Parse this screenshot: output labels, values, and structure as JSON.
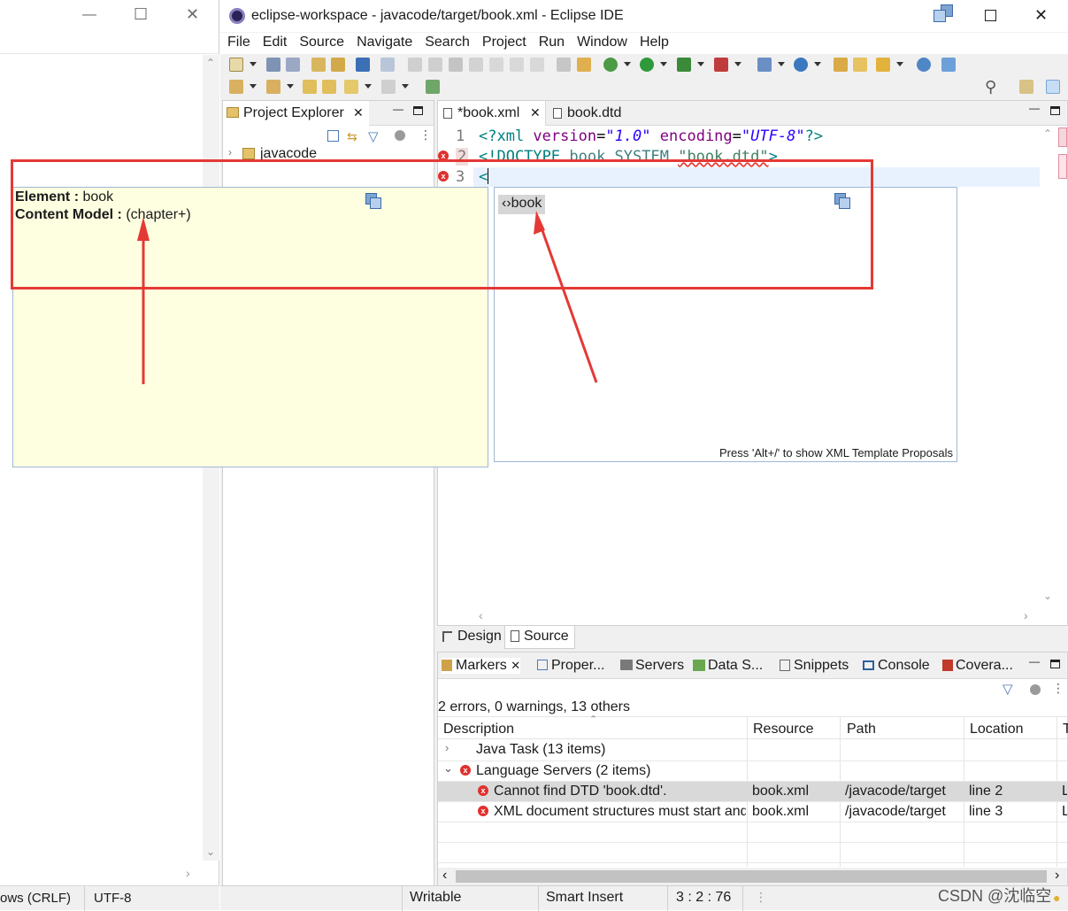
{
  "left_window": {
    "status_left": "ows (CRLF)",
    "status_encoding": "UTF-8"
  },
  "titlebar": {
    "title": "eclipse-workspace - javacode/target/book.xml - Eclipse IDE"
  },
  "menu": [
    "File",
    "Edit",
    "Source",
    "Navigate",
    "Search",
    "Project",
    "Run",
    "Window",
    "Help"
  ],
  "project_explorer": {
    "tab_label": "Project Explorer",
    "tree_item": "javacode"
  },
  "editor": {
    "tabs": [
      {
        "label": "*book.xml"
      },
      {
        "label": "book.dtd"
      }
    ],
    "line_numbers": [
      "1",
      "2",
      "3"
    ],
    "line1": {
      "open": "<?xml ",
      "attr1": "version",
      "eq1": "=",
      "val1": "\"1.0\"",
      "sp": " ",
      "attr2": "encoding",
      "eq2": "=",
      "val2": "\"UTF-8\"",
      "close": "?>"
    },
    "line2": {
      "open": "<!DOCTYPE ",
      "name": "book",
      "system": " SYSTEM ",
      "dtd": "\"book.dtd\"",
      "close": ">"
    },
    "line3": "<",
    "bottom_tabs": [
      "Design",
      "Source"
    ]
  },
  "info_popup": {
    "element_label": "Element :",
    "element_value": " book",
    "content_label": "Content Model :",
    "content_value": " (chapter+)"
  },
  "proposal_popup": {
    "item_glyph": "‹›",
    "item_label": "book",
    "footer": "Press 'Alt+/' to show XML Template Proposals"
  },
  "markers": {
    "tabs": [
      {
        "label": "Markers",
        "icon": "markers-icon"
      },
      {
        "label": "Proper...",
        "icon": "properties-icon"
      },
      {
        "label": "Servers",
        "icon": "servers-icon"
      },
      {
        "label": "Data S...",
        "icon": "data-source-icon"
      },
      {
        "label": "Snippets",
        "icon": "snippets-icon"
      },
      {
        "label": "Console",
        "icon": "console-icon"
      },
      {
        "label": "Covera...",
        "icon": "coverage-icon"
      }
    ],
    "summary": "2 errors, 0 warnings, 13 others",
    "columns": [
      "Description",
      "Resource",
      "Path",
      "Location",
      "T"
    ],
    "groups": [
      {
        "label": "Java Task (13 items)",
        "expanded": false
      },
      {
        "label": "Language Servers (2 items)",
        "expanded": true
      }
    ],
    "rows": [
      {
        "description": "Cannot find DTD 'book.dtd'.",
        "resource": "book.xml",
        "path": "/javacode/target",
        "location": "line 2",
        "type": "L"
      },
      {
        "description": "XML document structures must start and end within the same entity.",
        "resource": "book.xml",
        "path": "/javacode/target",
        "location": "line 3",
        "type": "L"
      }
    ]
  },
  "statusbar": {
    "writable": "Writable",
    "insert_mode": "Smart Insert",
    "position": "3 : 2 : 76"
  },
  "watermark": "CSDN @沈临空",
  "colors": {
    "xml_tag": "#008080",
    "xml_attr": "#7f007f",
    "xml_value": "#2a00ff",
    "annotation_red": "#e53935",
    "info_bg": "#fefee0",
    "error_red": "#e0302e"
  }
}
